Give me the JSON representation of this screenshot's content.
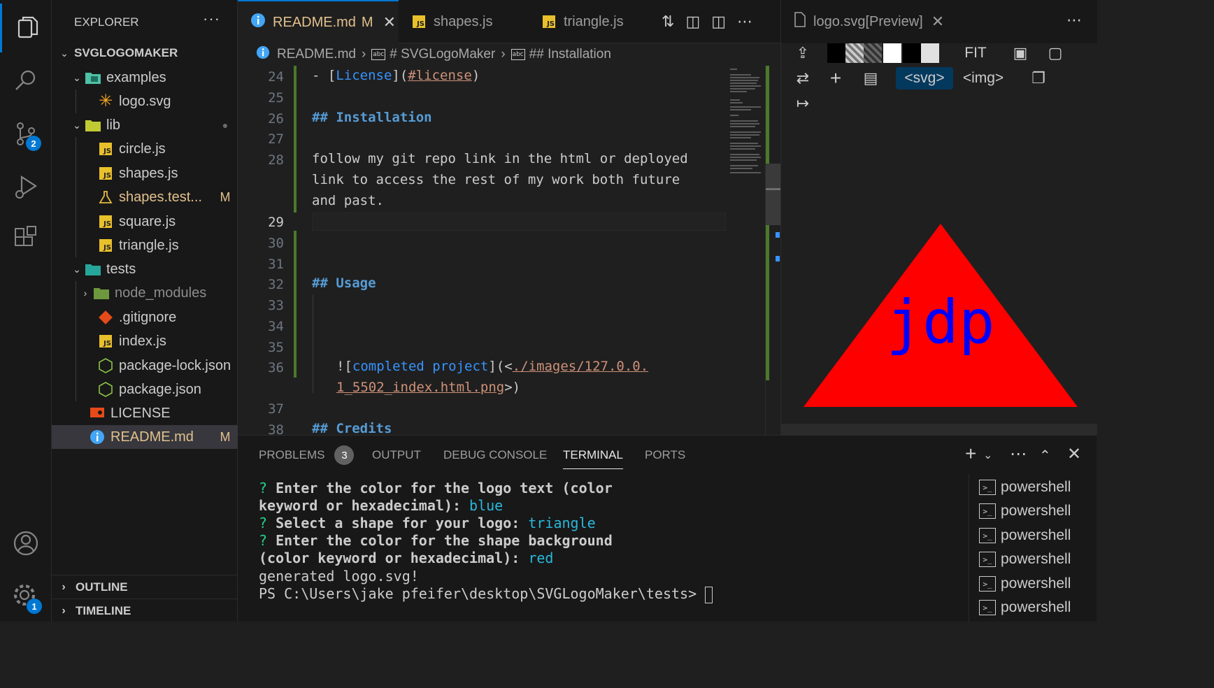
{
  "activity": {
    "scm_badge": "2",
    "settings_badge": "1"
  },
  "sidebar": {
    "title": "EXPLORER",
    "more": "···",
    "root": "SVGLOGOMAKER",
    "tree": [
      {
        "name": "examples",
        "status": ""
      },
      {
        "name": "logo.svg",
        "status": ""
      },
      {
        "name": "lib",
        "status": "●"
      },
      {
        "name": "circle.js",
        "status": ""
      },
      {
        "name": "shapes.js",
        "status": ""
      },
      {
        "name": "shapes.test...",
        "status": "M"
      },
      {
        "name": "square.js",
        "status": ""
      },
      {
        "name": "triangle.js",
        "status": ""
      },
      {
        "name": "tests",
        "status": ""
      },
      {
        "name": "node_modules",
        "status": ""
      },
      {
        "name": ".gitignore",
        "status": ""
      },
      {
        "name": "index.js",
        "status": ""
      },
      {
        "name": "package-lock.json",
        "status": ""
      },
      {
        "name": "package.json",
        "status": ""
      },
      {
        "name": "LICENSE",
        "status": ""
      },
      {
        "name": "README.md",
        "status": "M"
      }
    ],
    "outline": "OUTLINE",
    "timeline": "TIMELINE"
  },
  "tabs": [
    {
      "label": "README.md",
      "status": "M"
    },
    {
      "label": "shapes.js"
    },
    {
      "label": "triangle.js"
    }
  ],
  "breadcrumb": [
    "README.md",
    "# SVGLogoMaker",
    "## Installation"
  ],
  "editor": {
    "lines": [
      {
        "n": "24",
        "text": "- [License](#license)"
      },
      {
        "n": "25",
        "text": ""
      },
      {
        "n": "26",
        "text": "## Installation"
      },
      {
        "n": "27",
        "text": ""
      },
      {
        "n": "28",
        "text": "follow my git repo link in the html or deployed"
      },
      {
        "n": "",
        "text": "link to access the rest of my work both future"
      },
      {
        "n": "",
        "text": "and past."
      },
      {
        "n": "29",
        "text": ""
      },
      {
        "n": "30",
        "text": ""
      },
      {
        "n": "31",
        "text": ""
      },
      {
        "n": "32",
        "text": "## Usage"
      },
      {
        "n": "33",
        "text": ""
      },
      {
        "n": "34",
        "text": ""
      },
      {
        "n": "35",
        "text": ""
      },
      {
        "n": "36",
        "text": "![completed project](<./images/127.0.0."
      },
      {
        "n": "",
        "text": "1_5502_index.html.png>)"
      },
      {
        "n": "37",
        "text": ""
      },
      {
        "n": "38",
        "text": "## Credits"
      }
    ]
  },
  "preview": {
    "tab": "logo.svg[Preview]",
    "fit": "FIT",
    "svg_btn": "<svg>",
    "img_btn": "<img>",
    "logo_text": "jdp",
    "shape_color": "#ff0000",
    "text_color": "#0000ff"
  },
  "panel": {
    "tabs": [
      "PROBLEMS",
      "OUTPUT",
      "DEBUG CONSOLE",
      "TERMINAL",
      "PORTS"
    ],
    "problems_count": "3",
    "terminal": {
      "q1a": "Enter the color for the logo text (color",
      "q1b": "keyword or hexadecimal):",
      "a1": "blue",
      "q2": "Select a shape for your logo:",
      "a2": "triangle",
      "q3a": "Enter the color for the shape background",
      "q3b": "(color keyword or hexadecimal):",
      "a3": "red",
      "out": "generated logo.svg!",
      "prompt": "PS C:\\Users\\jake pfeifer\\desktop\\SVGLogoMaker\\tests>"
    },
    "shells": [
      "powershell",
      "powershell",
      "powershell",
      "powershell",
      "powershell",
      "powershell"
    ]
  }
}
